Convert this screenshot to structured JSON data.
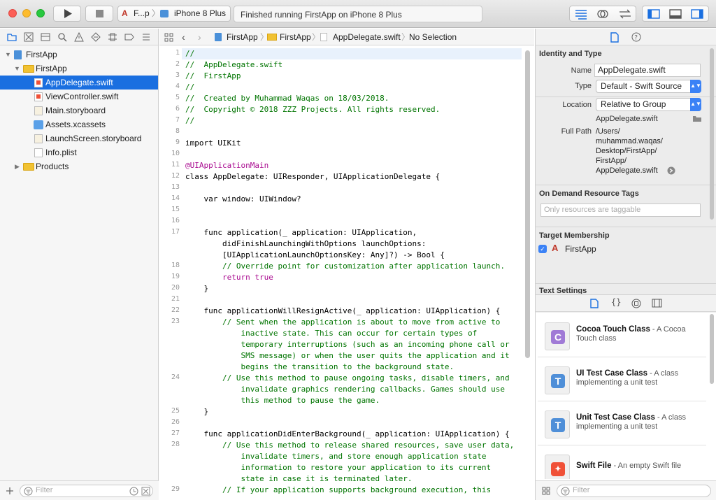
{
  "toolbar": {
    "scheme": "F...p",
    "device": "iPhone 8 Plus",
    "status": "Finished running FirstApp on iPhone 8 Plus"
  },
  "navigator": {
    "tree": [
      {
        "label": "FirstApp",
        "kind": "project",
        "depth": 0,
        "expanded": true
      },
      {
        "label": "FirstApp",
        "kind": "folder",
        "depth": 1,
        "expanded": true
      },
      {
        "label": "AppDelegate.swift",
        "kind": "swift",
        "depth": 2,
        "selected": true
      },
      {
        "label": "ViewController.swift",
        "kind": "swift",
        "depth": 2
      },
      {
        "label": "Main.storyboard",
        "kind": "storyboard",
        "depth": 2
      },
      {
        "label": "Assets.xcassets",
        "kind": "assets",
        "depth": 2
      },
      {
        "label": "LaunchScreen.storyboard",
        "kind": "storyboard",
        "depth": 2
      },
      {
        "label": "Info.plist",
        "kind": "plist",
        "depth": 2
      },
      {
        "label": "Products",
        "kind": "folder",
        "depth": 1,
        "expanded": false
      }
    ],
    "filter_placeholder": "Filter"
  },
  "jumpbar": {
    "crumbs": [
      "FirstApp",
      "FirstApp",
      "AppDelegate.swift",
      "No Selection"
    ]
  },
  "editor": {
    "lines": [
      {
        "n": "1",
        "text": "//",
        "cls": "c-com"
      },
      {
        "n": "2",
        "text": "//  AppDelegate.swift",
        "cls": "c-com"
      },
      {
        "n": "3",
        "text": "//  FirstApp",
        "cls": "c-com"
      },
      {
        "n": "4",
        "text": "//",
        "cls": "c-com"
      },
      {
        "n": "5",
        "text": "//  Created by Muhammad Waqas on 18/03/2018.",
        "cls": "c-com"
      },
      {
        "n": "6",
        "text": "//  Copyright © 2018 ZZZ Projects. All rights reserved.",
        "cls": "c-com"
      },
      {
        "n": "7",
        "text": "//",
        "cls": "c-com"
      },
      {
        "n": "8",
        "text": "",
        "cls": ""
      },
      {
        "n": "9",
        "text": "import UIKit",
        "cls": ""
      },
      {
        "n": "10",
        "text": "",
        "cls": ""
      },
      {
        "n": "11",
        "text": "@UIApplicationMain",
        "cls": "c-kw"
      },
      {
        "n": "12",
        "text": "class AppDelegate: UIResponder, UIApplicationDelegate {",
        "cls": ""
      },
      {
        "n": "13",
        "text": "",
        "cls": ""
      },
      {
        "n": "14",
        "text": "    var window: UIWindow?",
        "cls": ""
      },
      {
        "n": "15",
        "text": "",
        "cls": ""
      },
      {
        "n": "16",
        "text": "",
        "cls": ""
      },
      {
        "n": "17",
        "text": "    func application(_ application: UIApplication,",
        "cls": ""
      },
      {
        "n": "",
        "text": "        didFinishLaunchingWithOptions launchOptions:",
        "cls": ""
      },
      {
        "n": "",
        "text": "        [UIApplicationLaunchOptionsKey: Any]?) -> Bool {",
        "cls": ""
      },
      {
        "n": "18",
        "text": "        // Override point for customization after application launch.",
        "cls": "c-com"
      },
      {
        "n": "19",
        "text": "        return true",
        "cls": "c-kw"
      },
      {
        "n": "20",
        "text": "    }",
        "cls": ""
      },
      {
        "n": "21",
        "text": "",
        "cls": ""
      },
      {
        "n": "22",
        "text": "    func applicationWillResignActive(_ application: UIApplication) {",
        "cls": ""
      },
      {
        "n": "23",
        "text": "        // Sent when the application is about to move from active to",
        "cls": "c-com"
      },
      {
        "n": "",
        "text": "            inactive state. This can occur for certain types of",
        "cls": "c-com"
      },
      {
        "n": "",
        "text": "            temporary interruptions (such as an incoming phone call or",
        "cls": "c-com"
      },
      {
        "n": "",
        "text": "            SMS message) or when the user quits the application and it",
        "cls": "c-com"
      },
      {
        "n": "",
        "text": "            begins the transition to the background state.",
        "cls": "c-com"
      },
      {
        "n": "24",
        "text": "        // Use this method to pause ongoing tasks, disable timers, and",
        "cls": "c-com"
      },
      {
        "n": "",
        "text": "            invalidate graphics rendering callbacks. Games should use",
        "cls": "c-com"
      },
      {
        "n": "",
        "text": "            this method to pause the game.",
        "cls": "c-com"
      },
      {
        "n": "25",
        "text": "    }",
        "cls": ""
      },
      {
        "n": "26",
        "text": "",
        "cls": ""
      },
      {
        "n": "27",
        "text": "    func applicationDidEnterBackground(_ application: UIApplication) {",
        "cls": ""
      },
      {
        "n": "28",
        "text": "        // Use this method to release shared resources, save user data,",
        "cls": "c-com"
      },
      {
        "n": "",
        "text": "            invalidate timers, and store enough application state",
        "cls": "c-com"
      },
      {
        "n": "",
        "text": "            information to restore your application to its current",
        "cls": "c-com"
      },
      {
        "n": "",
        "text": "            state in case it is terminated later.",
        "cls": "c-com"
      },
      {
        "n": "29",
        "text": "        // If your application supports background execution, this",
        "cls": "c-com"
      }
    ]
  },
  "inspector": {
    "identity_title": "Identity and Type",
    "name_label": "Name",
    "name_value": "AppDelegate.swift",
    "type_label": "Type",
    "type_value": "Default - Swift Source",
    "location_label": "Location",
    "location_value": "Relative to Group",
    "location_file": "AppDelegate.swift",
    "fullpath_label": "Full Path",
    "fullpath_lines": [
      "/Users/",
      "muhammad.waqas/",
      "Desktop/FirstApp/",
      "FirstApp/",
      "AppDelegate.swift"
    ],
    "odr_title": "On Demand Resource Tags",
    "odr_placeholder": "Only resources are taggable",
    "target_title": "Target Membership",
    "target_name": "FirstApp",
    "text_settings_title": "Text Settings"
  },
  "library": {
    "items": [
      {
        "name": "Cocoa Touch Class",
        "desc": " - A Cocoa Touch class",
        "badge": "C",
        "color": "#a07ad6"
      },
      {
        "name": "UI Test Case Class",
        "desc": " - A class implementing a unit test",
        "badge": "T",
        "color": "#4f8fd8"
      },
      {
        "name": "Unit Test Case Class",
        "desc": " - A class implementing a unit test",
        "badge": "T",
        "color": "#4f8fd8"
      },
      {
        "name": "Swift File",
        "desc": " - An empty Swift file",
        "badge": "S",
        "color": "#f05138"
      }
    ],
    "filter_placeholder": "Filter"
  }
}
